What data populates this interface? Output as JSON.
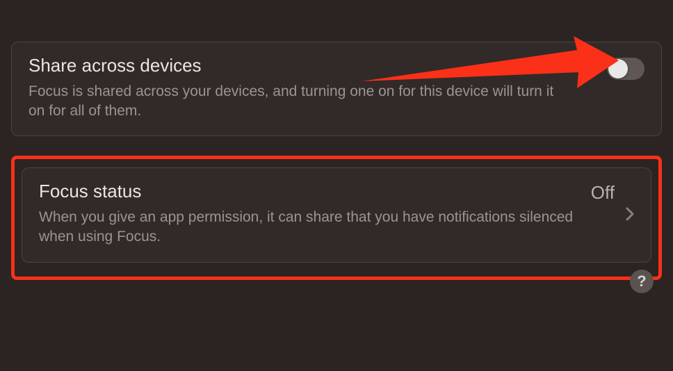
{
  "share": {
    "title": "Share across devices",
    "description": "Focus is shared across your devices, and turning one on for this device will turn it on for all of them.",
    "toggle_state": "off"
  },
  "focus_status": {
    "title": "Focus status",
    "description": "When you give an app permission, it can share that you have notifications silenced when using Focus.",
    "value": "Off"
  },
  "help_label": "?",
  "annotation": {
    "arrow_color": "#fa3018",
    "highlight_color": "#fa3018"
  }
}
